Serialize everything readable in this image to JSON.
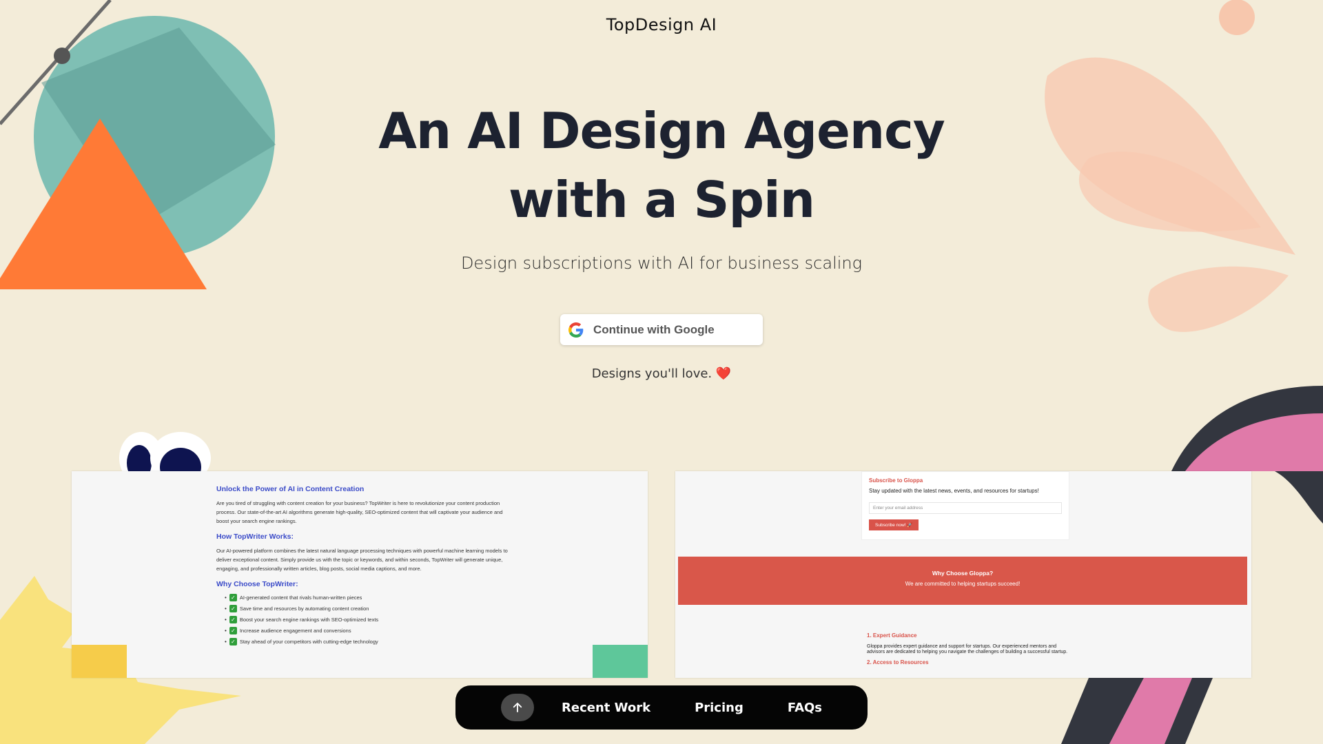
{
  "header": {
    "brand": "TopDesign AI"
  },
  "hero": {
    "title": "An AI Design Agency with a Spin",
    "subtitle": "Design subscriptions with AI for business scaling",
    "google_button_label": "Continue with Google",
    "tagline": "Designs you'll love.",
    "tagline_icon": "❤️"
  },
  "recent_work": [
    {
      "heading1": "Unlock the Power of AI in Content Creation",
      "para1": "Are you tired of struggling with content creation for your business? TopWriter is here to revolutionize your content production process. Our state-of-the-art AI algorithms generate high-quality, SEO-optimized content that will captivate your audience and boost your search engine rankings.",
      "heading2": "How TopWriter Works:",
      "para2": "Our AI-powered platform combines the latest natural language processing techniques with powerful machine learning models to deliver exceptional content. Simply provide us with the topic or keywords, and within seconds, TopWriter will generate unique, engaging, and professionally written articles, blog posts, social media captions, and more.",
      "heading3": "Why Choose TopWriter:",
      "items": [
        "AI-generated content that rivals human-written pieces",
        "Save time and resources by automating content creation",
        "Boost your search engine rankings with SEO-optimized texts",
        "Increase audience engagement and conversions",
        "Stay ahead of your competitors with cutting-edge technology"
      ]
    },
    {
      "subscribe_title": "Subscribe to Gloppa",
      "subscribe_desc": "Stay updated with the latest news, events, and resources for startups!",
      "email_placeholder": "Enter your email address",
      "subscribe_button": "Subscribe now! 🚀",
      "why_title": "Why Choose Gloppa?",
      "why_sub": "We are committed to helping startups succeed!",
      "guide1_title": "1. Expert Guidance",
      "guide1_text": "Gloppa provides expert guidance and support for startups. Our experienced mentors and advisors are dedicated to helping you navigate the challenges of building a successful startup.",
      "guide2_title": "2. Access to Resources"
    }
  ],
  "nav": {
    "items": [
      "Recent Work",
      "Pricing",
      "FAQs"
    ]
  },
  "colors": {
    "background": "#f3ecd9",
    "nav_bg": "#050505",
    "accent_red": "#d9574a"
  }
}
